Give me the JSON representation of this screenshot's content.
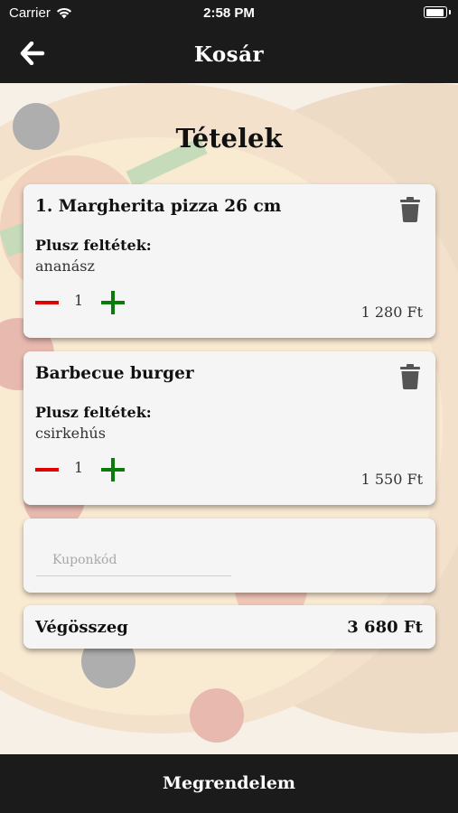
{
  "status": {
    "carrier": "Carrier",
    "time": "2:58 PM"
  },
  "header": {
    "title": "Kosár"
  },
  "main": {
    "section_title": "Tételek",
    "items": [
      {
        "name": "1. Margherita pizza 26 cm",
        "extras_label": "Plusz feltétek:",
        "extras": "ananász",
        "quantity": "1",
        "price": "1 280 Ft"
      },
      {
        "name": "Barbecue burger",
        "extras_label": "Plusz feltétek:",
        "extras": "csirkehús",
        "quantity": "1",
        "price": "1 550 Ft"
      }
    ],
    "coupon": {
      "placeholder": "Kuponkód",
      "value": ""
    },
    "total": {
      "label": "Végösszeg",
      "value": "3 680 Ft"
    }
  },
  "footer": {
    "order_button": "Megrendelem"
  },
  "colors": {
    "bar": "#1b1b1b",
    "minus": "#e00000",
    "plus": "#0a7a0a",
    "card": "#f5f5f5"
  },
  "icons": [
    "wifi-icon",
    "battery-icon",
    "back-arrow-icon",
    "trash-icon",
    "minus-icon",
    "plus-icon"
  ]
}
